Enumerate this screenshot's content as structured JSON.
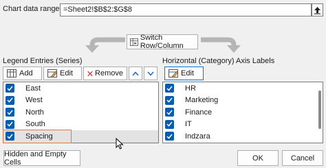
{
  "range": {
    "label": "Chart data range:",
    "value": "=Sheet2!$B$2:$G$8"
  },
  "switch_button": {
    "label": "Switch Row/Column"
  },
  "legend_section": {
    "title": "Legend Entries (Series)",
    "add_label": "Add",
    "edit_label": "Edit",
    "remove_label": "Remove",
    "items": [
      {
        "label": "East",
        "checked": true
      },
      {
        "label": "West",
        "checked": true
      },
      {
        "label": "North",
        "checked": true
      },
      {
        "label": "South",
        "checked": true
      },
      {
        "label": "Spacing",
        "checked": true
      }
    ]
  },
  "axis_section": {
    "title": "Horizontal (Category) Axis Labels",
    "edit_label": "Edit",
    "items": [
      {
        "label": "HR",
        "checked": true
      },
      {
        "label": "Marketing",
        "checked": true
      },
      {
        "label": "Finance",
        "checked": true
      },
      {
        "label": "IT",
        "checked": true
      },
      {
        "label": "Indzara",
        "checked": true
      }
    ]
  },
  "footer": {
    "hidden_cells_label": "Hidden and Empty Cells",
    "ok_label": "OK",
    "cancel_label": "Cancel"
  },
  "colors": {
    "checkbox": "#0b5cad",
    "highlight": "#e8763c",
    "focus_border": "#0078d4"
  }
}
